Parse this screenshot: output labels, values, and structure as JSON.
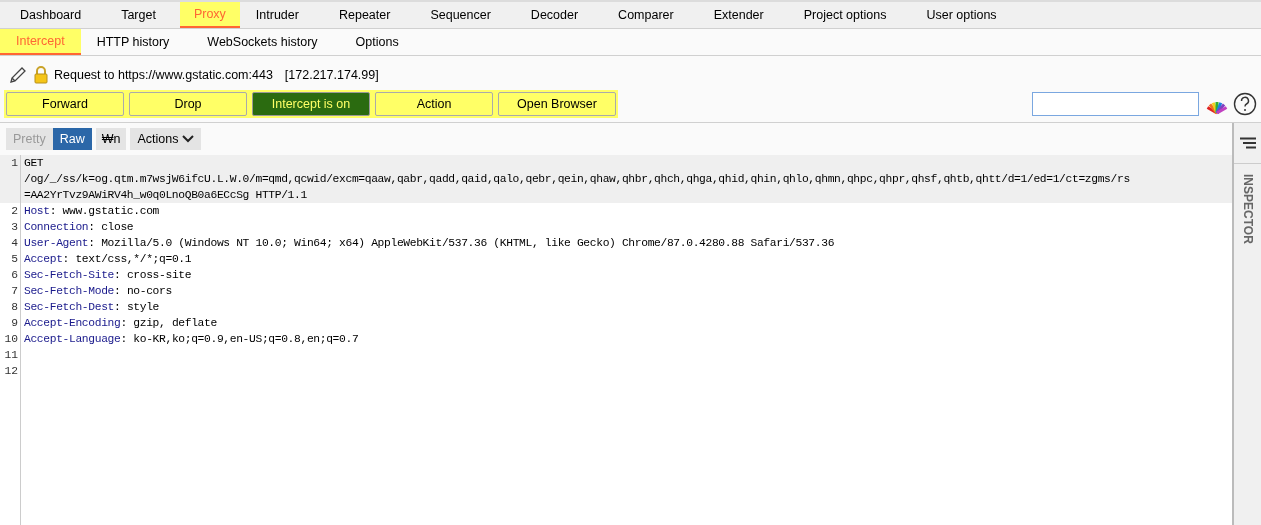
{
  "main_tabs": [
    {
      "label": "Dashboard",
      "selected": false
    },
    {
      "label": "Target",
      "selected": false
    },
    {
      "label": "Proxy",
      "selected": true
    },
    {
      "label": "Intruder",
      "selected": false
    },
    {
      "label": "Repeater",
      "selected": false
    },
    {
      "label": "Sequencer",
      "selected": false
    },
    {
      "label": "Decoder",
      "selected": false
    },
    {
      "label": "Comparer",
      "selected": false
    },
    {
      "label": "Extender",
      "selected": false
    },
    {
      "label": "Project options",
      "selected": false
    },
    {
      "label": "User options",
      "selected": false
    }
  ],
  "sub_tabs": [
    {
      "label": "Intercept",
      "selected": true
    },
    {
      "label": "HTTP history",
      "selected": false
    },
    {
      "label": "WebSockets history",
      "selected": false
    },
    {
      "label": "Options",
      "selected": false
    }
  ],
  "request_info": {
    "label": "Request to https://www.gstatic.com:443",
    "ip": "[172.217.174.99]"
  },
  "action_buttons": [
    {
      "label": "Forward",
      "on": false
    },
    {
      "label": "Drop",
      "on": false
    },
    {
      "label": "Intercept is on",
      "on": true
    },
    {
      "label": "Action",
      "on": false
    },
    {
      "label": "Open Browser",
      "on": false
    }
  ],
  "editor_toolbar": {
    "views": [
      {
        "label": "Pretty",
        "selected": false
      },
      {
        "label": "Raw",
        "selected": true
      }
    ],
    "newline_toggle": {
      "label": "₩n",
      "on": false
    },
    "actions_menu": "Actions"
  },
  "request_lines": [
    {
      "number": "1",
      "rows": [
        "GET",
        "/og/_/ss/k=og.qtm.m7wsjW6ifcU.L.W.0/m=qmd,qcwid/excm=qaaw,qabr,qadd,qaid,qalo,qebr,qein,qhaw,qhbr,qhch,qhga,qhid,qhin,qhlo,qhmn,qhpc,qhpr,qhsf,qhtb,qhtt/d=1/ed=1/ct=zgms/rs",
        "=AA2YrTvz9AWiRV4h_w0q0LnoQB0a6ECcSg HTTP/1.1"
      ],
      "current": true
    },
    {
      "number": "2",
      "header": "Host",
      "separator": ": ",
      "value": "www.gstatic.com",
      "current": false
    },
    {
      "number": "3",
      "header": "Connection",
      "separator": ": ",
      "value": "close",
      "current": false
    },
    {
      "number": "4",
      "header": "User-Agent",
      "separator": ": ",
      "value": "Mozilla/5.0 (Windows NT 10.0; Win64; x64) AppleWebKit/537.36 (KHTML, like Gecko) Chrome/87.0.4280.88 Safari/537.36",
      "current": false
    },
    {
      "number": "5",
      "header": "Accept",
      "separator": ": ",
      "value": "text/css,*/*;q=0.1",
      "current": false
    },
    {
      "number": "6",
      "header": "Sec-Fetch-Site",
      "separator": ": ",
      "value": "cross-site",
      "current": false
    },
    {
      "number": "7",
      "header": "Sec-Fetch-Mode",
      "separator": ": ",
      "value": "no-cors",
      "current": false
    },
    {
      "number": "8",
      "header": "Sec-Fetch-Dest",
      "separator": ": ",
      "value": "style",
      "current": false
    },
    {
      "number": "9",
      "header": "Accept-Encoding",
      "separator": ": ",
      "value": "gzip, deflate",
      "current": false
    },
    {
      "number": "10",
      "header": "Accept-Language",
      "separator": ": ",
      "value": "ko-KR,ko;q=0.9,en-US;q=0.8,en;q=0.7",
      "current": false
    },
    {
      "number": "11",
      "current": false
    },
    {
      "number": "12",
      "current": false
    }
  ],
  "inspector": {
    "label": "INSPECTOR"
  }
}
